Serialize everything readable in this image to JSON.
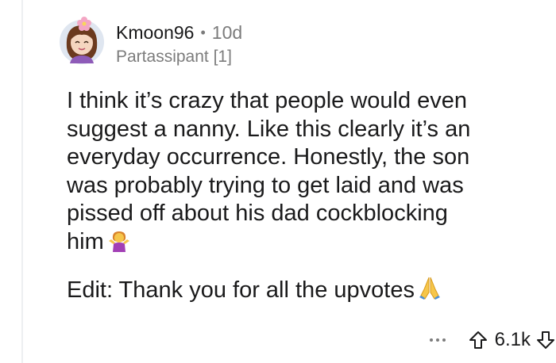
{
  "comment": {
    "username": "Kmoon96",
    "separator": "•",
    "age": "10d",
    "flair": "Partassipant [1]",
    "body_lines": [
      "I think it’s crazy that people would even",
      "suggest a nanny. Like this clearly it’s an",
      "everyday occurrence. Honestly, the son",
      "was probably trying to get laid and was",
      "pissed off about his dad cockblocking",
      "him"
    ],
    "emoji_1": "woman-shrugging-emoji",
    "edit_text": "Edit: Thank you for all the upvotes",
    "emoji_2": "folded-hands-emoji"
  },
  "actions": {
    "score": "6.1k",
    "more_icon": "more-options-icon",
    "upvote_icon": "upvote-arrow-icon",
    "downvote_icon": "downvote-arrow-icon"
  },
  "colors": {
    "text": "#1a1a1b",
    "meta": "#7c7c7c",
    "thread_line": "#edeff1"
  }
}
